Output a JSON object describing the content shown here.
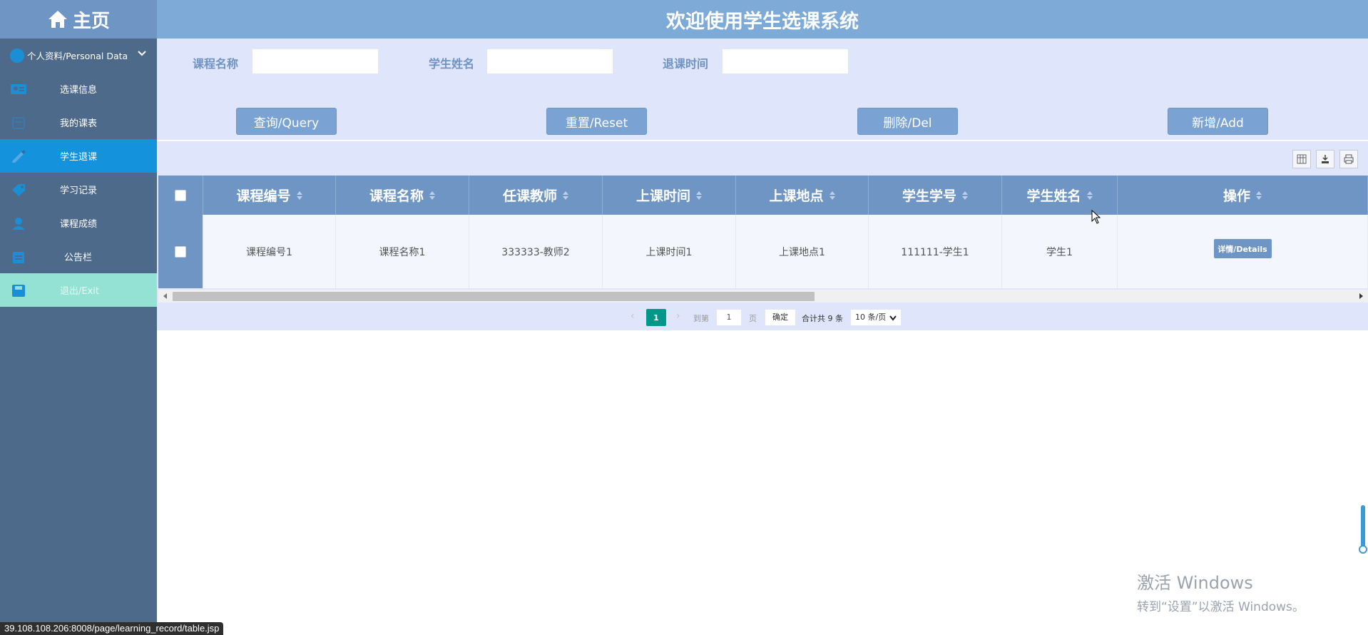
{
  "brand": {
    "label": "主页",
    "icon": "home-icon"
  },
  "header": {
    "title": "欢迎使用学生选课系统"
  },
  "sidebar": {
    "profile": {
      "label": "个人资料/Personal Data",
      "icon": "avatar-icon"
    },
    "items": [
      {
        "label": "选课信息",
        "icon": "id-card-icon"
      },
      {
        "label": "我的课表",
        "icon": "calendar-icon"
      },
      {
        "label": "学生退课",
        "icon": "pencil-icon",
        "active": true
      },
      {
        "label": "学习记录",
        "icon": "tag-icon"
      },
      {
        "label": "课程成绩",
        "icon": "user-grade-icon"
      },
      {
        "label": "公告栏",
        "icon": "clipboard-icon"
      },
      {
        "label": "退出/Exit",
        "icon": "save-exit-icon"
      }
    ]
  },
  "search": {
    "course_name_label": "课程名称",
    "student_name_label": "学生姓名",
    "drop_time_label": "退课时间",
    "course_name_value": "",
    "student_name_value": "",
    "drop_time_value": ""
  },
  "actions": {
    "query": "查询/Query",
    "reset": "重置/Reset",
    "delete": "删除/Del",
    "add": "新增/Add"
  },
  "toolbar": {
    "icons": [
      "columns-icon",
      "export-icon",
      "print-icon"
    ]
  },
  "table": {
    "columns": [
      "课程编号",
      "课程名称",
      "任课教师",
      "上课时间",
      "上课地点",
      "学生学号",
      "学生姓名",
      "操作"
    ],
    "rows": [
      {
        "cells": [
          "课程编号1",
          "课程名称1",
          "333333-教师2",
          "上课时间1",
          "上课地点1",
          "111111-学生1",
          "学生1"
        ],
        "action": "详情/Details"
      }
    ]
  },
  "pager": {
    "current_page": "1",
    "goto_label": "到第",
    "goto_value": "1",
    "page_suffix": "页",
    "confirm": "确定",
    "total": "合计共 9 条",
    "page_size": "10 条/页"
  },
  "watermark": {
    "line1": "激活 Windows",
    "line2": "转到“设置”以激活 Windows。"
  },
  "status_url": "39.108.108.206:8008/page/learning_record/table.jsp",
  "colors": {
    "sidebar": "#4e6a8a",
    "header": "#7eaad8",
    "active": "#1493dc",
    "exit": "#93e2d3",
    "accent_green": "#009688"
  }
}
